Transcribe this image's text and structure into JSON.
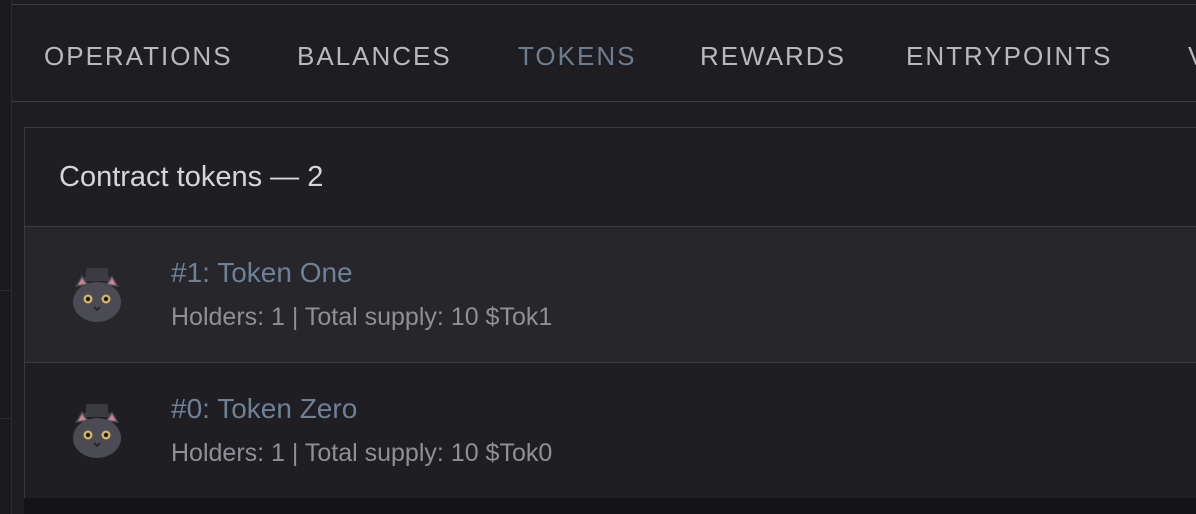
{
  "tabs": [
    {
      "label": "OPERATIONS",
      "active": false
    },
    {
      "label": "BALANCES",
      "active": false
    },
    {
      "label": "TOKENS",
      "active": true
    },
    {
      "label": "REWARDS",
      "active": false
    },
    {
      "label": "ENTRYPOINTS",
      "active": false
    },
    {
      "label": "V",
      "active": false
    }
  ],
  "tokens_section": {
    "title": "Contract tokens — 2",
    "items": [
      {
        "title": "#1: Token One",
        "subtitle": "Holders: 1 | Total supply: 10 $Tok1",
        "icon": "cat-avatar-icon"
      },
      {
        "title": "#0: Token Zero",
        "subtitle": "Holders: 1 | Total supply: 10 $Tok0",
        "icon": "cat-avatar-icon"
      }
    ]
  },
  "colors": {
    "background": "#1e1e22",
    "active_tab": "#6e7d8e",
    "link": "#6e8196",
    "muted_text": "#8f8f95"
  }
}
